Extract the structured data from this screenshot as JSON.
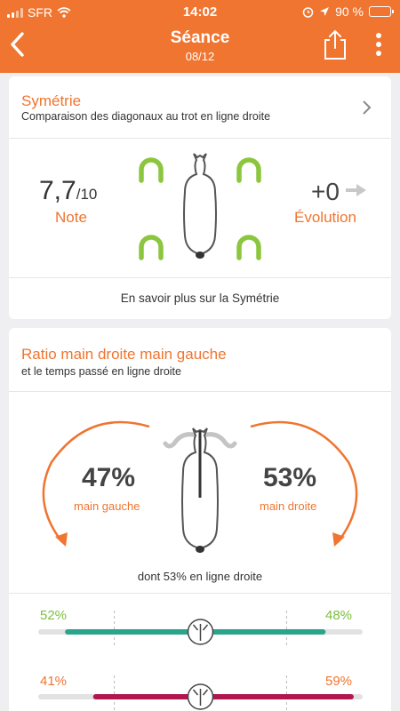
{
  "status": {
    "carrier": "SFR",
    "time": "14:02",
    "battery_text": "90 %",
    "battery_level": 0.9
  },
  "nav": {
    "title": "Séance",
    "subtitle": "08/12"
  },
  "symmetry": {
    "title": "Symétrie",
    "subtitle": "Comparaison des diagonaux au trot en ligne droite",
    "score": "7,7",
    "score_max": "/10",
    "score_label": "Note",
    "evolution": "+0",
    "evolution_label": "Évolution",
    "more_link": "En savoir plus sur la Symétrie"
  },
  "ratio": {
    "title": "Ratio main droite main gauche",
    "subtitle": "et le temps passé en ligne droite",
    "left_pct": "47%",
    "left_label": "main gauche",
    "right_pct": "53%",
    "right_label": "main droite",
    "straight_note": "dont 53% en ligne droite",
    "rows": [
      {
        "left": "52%",
        "right": "48%",
        "left_value": 52,
        "right_value": 48
      },
      {
        "left": "41%",
        "right": "59%",
        "left_value": 41,
        "right_value": 59
      }
    ]
  },
  "colors": {
    "accent": "#ef7530",
    "horseshoe": "#8cc63f",
    "bar_teal": "#2aa58c",
    "bar_crimson": "#b0174e",
    "bar_track": "#e2e2e2"
  }
}
